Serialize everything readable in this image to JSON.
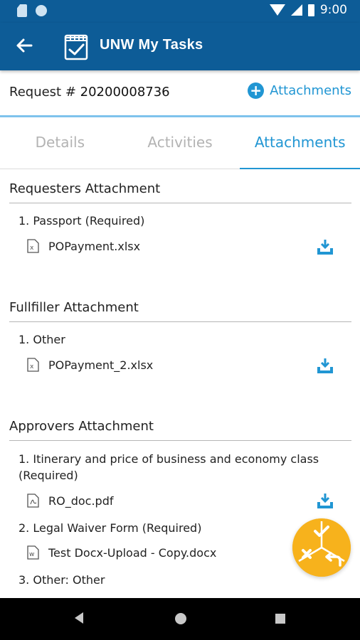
{
  "status_bar": {
    "time": "9:00"
  },
  "app_bar": {
    "title": "UNW My Tasks"
  },
  "request": {
    "label": "Request # ",
    "number": "20200008736",
    "attachments_button": "Attachments"
  },
  "tabs": [
    {
      "label": "Details"
    },
    {
      "label": "Activities"
    },
    {
      "label": "Attachments"
    }
  ],
  "sections": [
    {
      "title": "Requesters Attachment",
      "items": [
        {
          "label": "1. Passport (Required)",
          "file": "POPayment.xlsx"
        }
      ]
    },
    {
      "title": "Fullfiller Attachment",
      "items": [
        {
          "label": "1. Other",
          "file": "POPayment_2.xlsx"
        }
      ]
    },
    {
      "title": "Approvers Attachment",
      "items": [
        {
          "label": "1. Itinerary and price of business and economy class (Required)",
          "file": "RO_doc.pdf"
        },
        {
          "label": "2. Legal Waiver Form (Required)",
          "file": "Test Docx-Upload - Copy.docx"
        },
        {
          "label": "3. Other: Other",
          "file": ""
        }
      ]
    }
  ],
  "colors": {
    "primary": "#0d5c97",
    "accent": "#2196d3",
    "fab": "#f7b21c"
  }
}
